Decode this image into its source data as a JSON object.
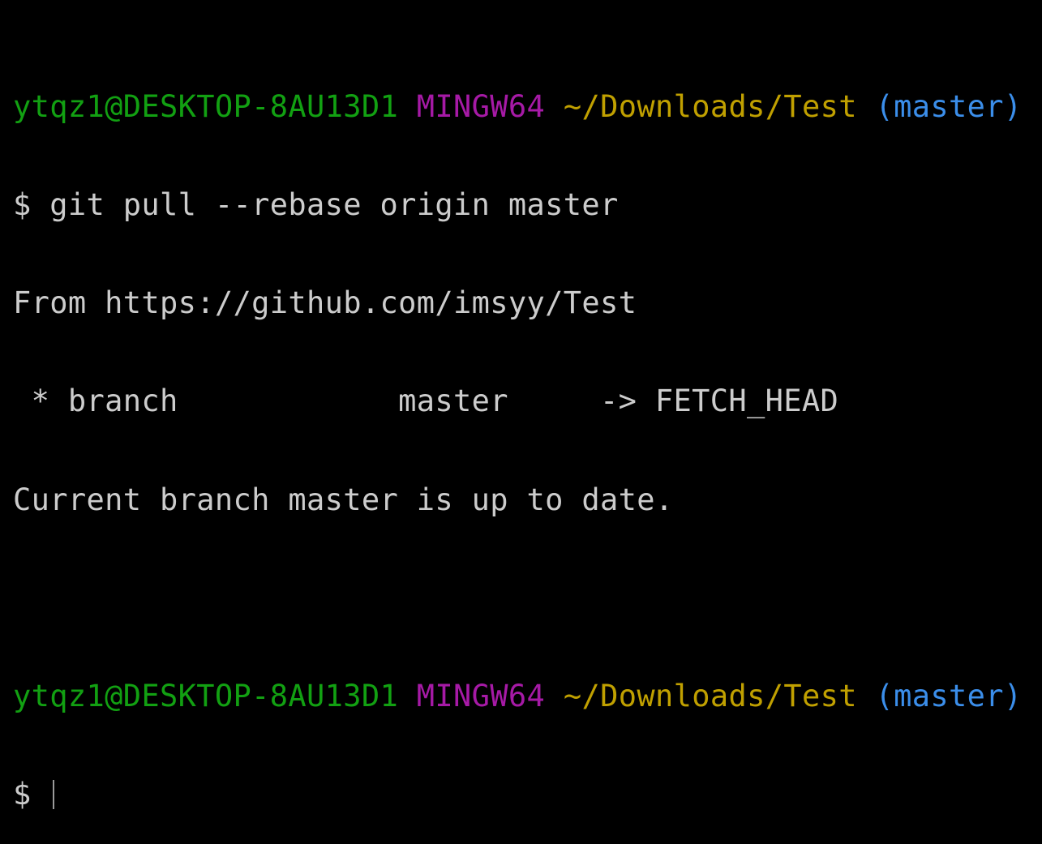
{
  "terminal": {
    "prompt1": {
      "user_host": "ytqz1@DESKTOP-8AU13D1",
      "system": "MINGW64",
      "path": "~/Downloads/Test",
      "branch": "(master)"
    },
    "command_line": "$ git pull --rebase origin master",
    "output": [
      "From https://github.com/imsyy/Test",
      " * branch            master     -> FETCH_HEAD",
      "Current branch master is up to date."
    ],
    "prompt2": {
      "user_host": "ytqz1@DESKTOP-8AU13D1",
      "system": "MINGW64",
      "path": "~/Downloads/Test",
      "branch": "(master)"
    },
    "input_prompt": "$ ",
    "colors": {
      "background": "#000000",
      "text": "#cccccc",
      "user_host": "#12a012",
      "system": "#a61aa6",
      "path": "#c0a000",
      "branch": "#3b8eea"
    }
  }
}
